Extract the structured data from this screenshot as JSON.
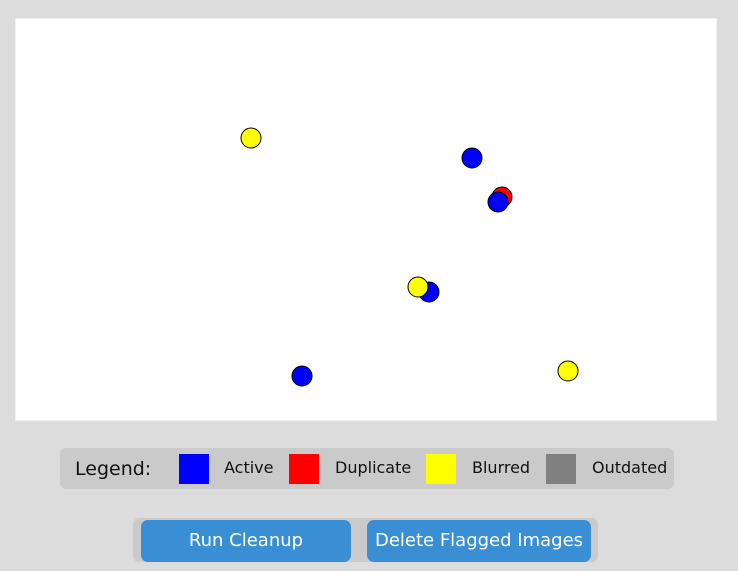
{
  "legend": {
    "title": "Legend:",
    "items": [
      {
        "label": "Active",
        "color": "#0000ff"
      },
      {
        "label": "Duplicate",
        "color": "#ff0000"
      },
      {
        "label": "Blurred",
        "color": "#ffff00"
      },
      {
        "label": "Outdated",
        "color": "#808080"
      }
    ]
  },
  "buttons": {
    "run_cleanup": "Run Cleanup",
    "delete_flagged": "Delete Flagged Images"
  },
  "image_markers": [
    {
      "status": "Blurred"
    },
    {
      "status": "Active"
    },
    {
      "status": "Duplicate"
    },
    {
      "status": "Active"
    },
    {
      "status": "Active"
    },
    {
      "status": "Blurred"
    },
    {
      "status": "Active"
    },
    {
      "status": "Blurred"
    }
  ]
}
